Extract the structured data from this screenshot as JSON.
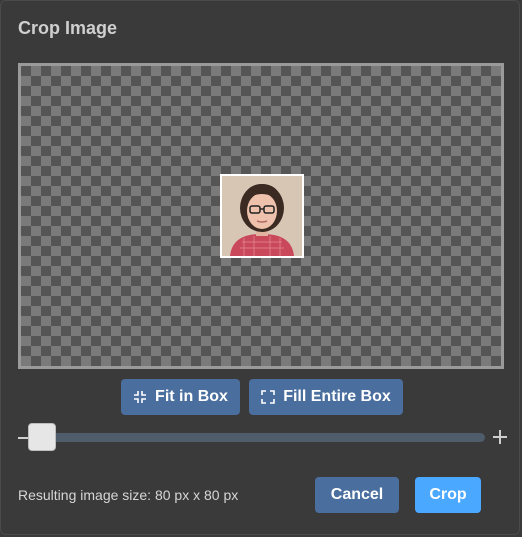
{
  "dialog": {
    "title": "Crop Image",
    "buttons": {
      "fit": "Fit in Box",
      "fill": "Fill Entire Box",
      "cancel": "Cancel",
      "crop": "Crop"
    },
    "zoom_slider": {
      "value": 0.0
    },
    "result_text": "Resulting image size: 80 px x 80 px"
  },
  "icons": {
    "fit": "shrink-icon",
    "fill": "expand-icon",
    "zoom_out": "minus-icon",
    "zoom_in": "plus-icon"
  },
  "colors": {
    "background": "#3a3a3a",
    "button_muted": "#4a6f9f",
    "button_primary": "#4aa8ff",
    "slider_track": "#4f5c6b"
  }
}
